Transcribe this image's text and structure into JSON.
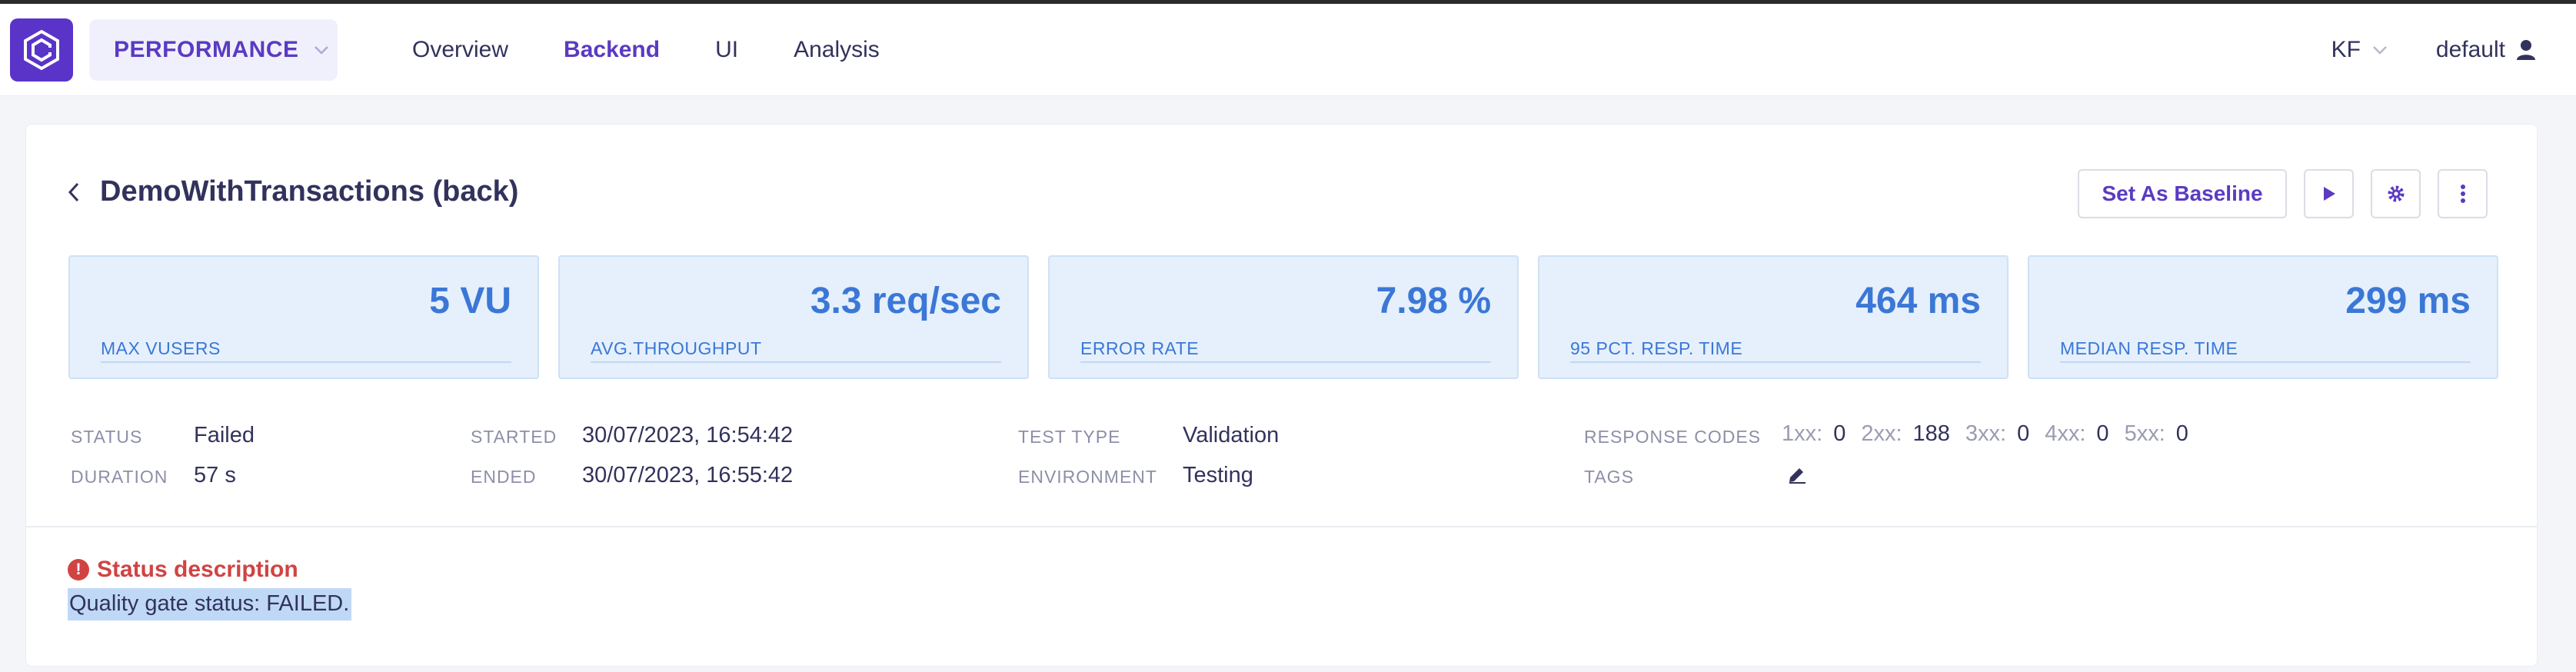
{
  "nav": {
    "project": "PERFORMANCE",
    "tabs": [
      {
        "label": "Overview",
        "active": false
      },
      {
        "label": "Backend",
        "active": true
      },
      {
        "label": "UI",
        "active": false
      },
      {
        "label": "Analysis",
        "active": false
      }
    ],
    "user_initials": "KF",
    "user_name": "default"
  },
  "test": {
    "title": "DemoWithTransactions (back)",
    "actions": {
      "baseline_label": "Set As Baseline",
      "run_icon": "play-icon",
      "settings_icon": "gear-icon",
      "more_icon": "more-vertical-icon"
    }
  },
  "metrics": [
    {
      "value": "5 VU",
      "label": "MAX VUSERS"
    },
    {
      "value": "3.3 req/sec",
      "label": "AVG.THROUGHPUT"
    },
    {
      "value": "7.98 %",
      "label": "ERROR RATE"
    },
    {
      "value": "464 ms",
      "label": "95 PCT. RESP. TIME"
    },
    {
      "value": "299 ms",
      "label": "MEDIAN RESP. TIME"
    }
  ],
  "info": {
    "status_label": "STATUS",
    "status": "Failed",
    "duration_label": "DURATION",
    "duration": "57 s",
    "started_label": "STARTED",
    "started": "30/07/2023, 16:54:42",
    "ended_label": "ENDED",
    "ended": "30/07/2023, 16:55:42",
    "test_type_label": "TEST TYPE",
    "test_type": "Validation",
    "environment_label": "ENVIRONMENT",
    "environment": "Testing",
    "response_codes_label": "RESPONSE CODES",
    "response_codes": [
      {
        "code": "1xx:",
        "count": "0"
      },
      {
        "code": "2xx:",
        "count": "188"
      },
      {
        "code": "3xx:",
        "count": "0"
      },
      {
        "code": "4xx:",
        "count": "0"
      },
      {
        "code": "5xx:",
        "count": "0"
      }
    ],
    "tags_label": "TAGS"
  },
  "status_description": {
    "title": "Status description",
    "text": "Quality gate status: FAILED."
  },
  "colors": {
    "brand": "#5a34c9",
    "metric_text": "#3b77d6",
    "metric_bg": "#e5f0fc",
    "error": "#d14343",
    "selection": "#bfd8f6"
  }
}
